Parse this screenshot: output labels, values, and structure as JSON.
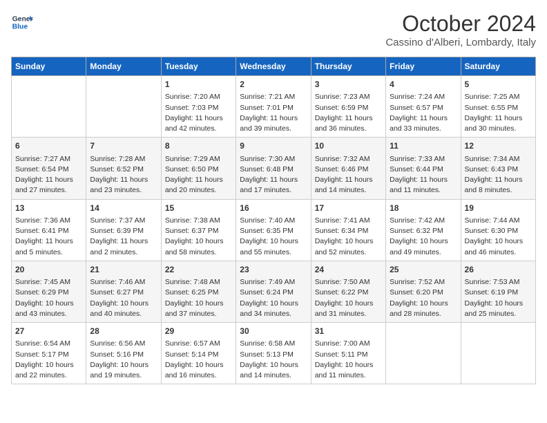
{
  "header": {
    "logo_line1": "General",
    "logo_line2": "Blue",
    "month_title": "October 2024",
    "location": "Cassino d'Alberi, Lombardy, Italy"
  },
  "days_of_week": [
    "Sunday",
    "Monday",
    "Tuesday",
    "Wednesday",
    "Thursday",
    "Friday",
    "Saturday"
  ],
  "weeks": [
    [
      {
        "day": "",
        "data": ""
      },
      {
        "day": "",
        "data": ""
      },
      {
        "day": "1",
        "data": "Sunrise: 7:20 AM\nSunset: 7:03 PM\nDaylight: 11 hours and 42 minutes."
      },
      {
        "day": "2",
        "data": "Sunrise: 7:21 AM\nSunset: 7:01 PM\nDaylight: 11 hours and 39 minutes."
      },
      {
        "day": "3",
        "data": "Sunrise: 7:23 AM\nSunset: 6:59 PM\nDaylight: 11 hours and 36 minutes."
      },
      {
        "day": "4",
        "data": "Sunrise: 7:24 AM\nSunset: 6:57 PM\nDaylight: 11 hours and 33 minutes."
      },
      {
        "day": "5",
        "data": "Sunrise: 7:25 AM\nSunset: 6:55 PM\nDaylight: 11 hours and 30 minutes."
      }
    ],
    [
      {
        "day": "6",
        "data": "Sunrise: 7:27 AM\nSunset: 6:54 PM\nDaylight: 11 hours and 27 minutes."
      },
      {
        "day": "7",
        "data": "Sunrise: 7:28 AM\nSunset: 6:52 PM\nDaylight: 11 hours and 23 minutes."
      },
      {
        "day": "8",
        "data": "Sunrise: 7:29 AM\nSunset: 6:50 PM\nDaylight: 11 hours and 20 minutes."
      },
      {
        "day": "9",
        "data": "Sunrise: 7:30 AM\nSunset: 6:48 PM\nDaylight: 11 hours and 17 minutes."
      },
      {
        "day": "10",
        "data": "Sunrise: 7:32 AM\nSunset: 6:46 PM\nDaylight: 11 hours and 14 minutes."
      },
      {
        "day": "11",
        "data": "Sunrise: 7:33 AM\nSunset: 6:44 PM\nDaylight: 11 hours and 11 minutes."
      },
      {
        "day": "12",
        "data": "Sunrise: 7:34 AM\nSunset: 6:43 PM\nDaylight: 11 hours and 8 minutes."
      }
    ],
    [
      {
        "day": "13",
        "data": "Sunrise: 7:36 AM\nSunset: 6:41 PM\nDaylight: 11 hours and 5 minutes."
      },
      {
        "day": "14",
        "data": "Sunrise: 7:37 AM\nSunset: 6:39 PM\nDaylight: 11 hours and 2 minutes."
      },
      {
        "day": "15",
        "data": "Sunrise: 7:38 AM\nSunset: 6:37 PM\nDaylight: 10 hours and 58 minutes."
      },
      {
        "day": "16",
        "data": "Sunrise: 7:40 AM\nSunset: 6:35 PM\nDaylight: 10 hours and 55 minutes."
      },
      {
        "day": "17",
        "data": "Sunrise: 7:41 AM\nSunset: 6:34 PM\nDaylight: 10 hours and 52 minutes."
      },
      {
        "day": "18",
        "data": "Sunrise: 7:42 AM\nSunset: 6:32 PM\nDaylight: 10 hours and 49 minutes."
      },
      {
        "day": "19",
        "data": "Sunrise: 7:44 AM\nSunset: 6:30 PM\nDaylight: 10 hours and 46 minutes."
      }
    ],
    [
      {
        "day": "20",
        "data": "Sunrise: 7:45 AM\nSunset: 6:29 PM\nDaylight: 10 hours and 43 minutes."
      },
      {
        "day": "21",
        "data": "Sunrise: 7:46 AM\nSunset: 6:27 PM\nDaylight: 10 hours and 40 minutes."
      },
      {
        "day": "22",
        "data": "Sunrise: 7:48 AM\nSunset: 6:25 PM\nDaylight: 10 hours and 37 minutes."
      },
      {
        "day": "23",
        "data": "Sunrise: 7:49 AM\nSunset: 6:24 PM\nDaylight: 10 hours and 34 minutes."
      },
      {
        "day": "24",
        "data": "Sunrise: 7:50 AM\nSunset: 6:22 PM\nDaylight: 10 hours and 31 minutes."
      },
      {
        "day": "25",
        "data": "Sunrise: 7:52 AM\nSunset: 6:20 PM\nDaylight: 10 hours and 28 minutes."
      },
      {
        "day": "26",
        "data": "Sunrise: 7:53 AM\nSunset: 6:19 PM\nDaylight: 10 hours and 25 minutes."
      }
    ],
    [
      {
        "day": "27",
        "data": "Sunrise: 6:54 AM\nSunset: 5:17 PM\nDaylight: 10 hours and 22 minutes."
      },
      {
        "day": "28",
        "data": "Sunrise: 6:56 AM\nSunset: 5:16 PM\nDaylight: 10 hours and 19 minutes."
      },
      {
        "day": "29",
        "data": "Sunrise: 6:57 AM\nSunset: 5:14 PM\nDaylight: 10 hours and 16 minutes."
      },
      {
        "day": "30",
        "data": "Sunrise: 6:58 AM\nSunset: 5:13 PM\nDaylight: 10 hours and 14 minutes."
      },
      {
        "day": "31",
        "data": "Sunrise: 7:00 AM\nSunset: 5:11 PM\nDaylight: 10 hours and 11 minutes."
      },
      {
        "day": "",
        "data": ""
      },
      {
        "day": "",
        "data": ""
      }
    ]
  ]
}
